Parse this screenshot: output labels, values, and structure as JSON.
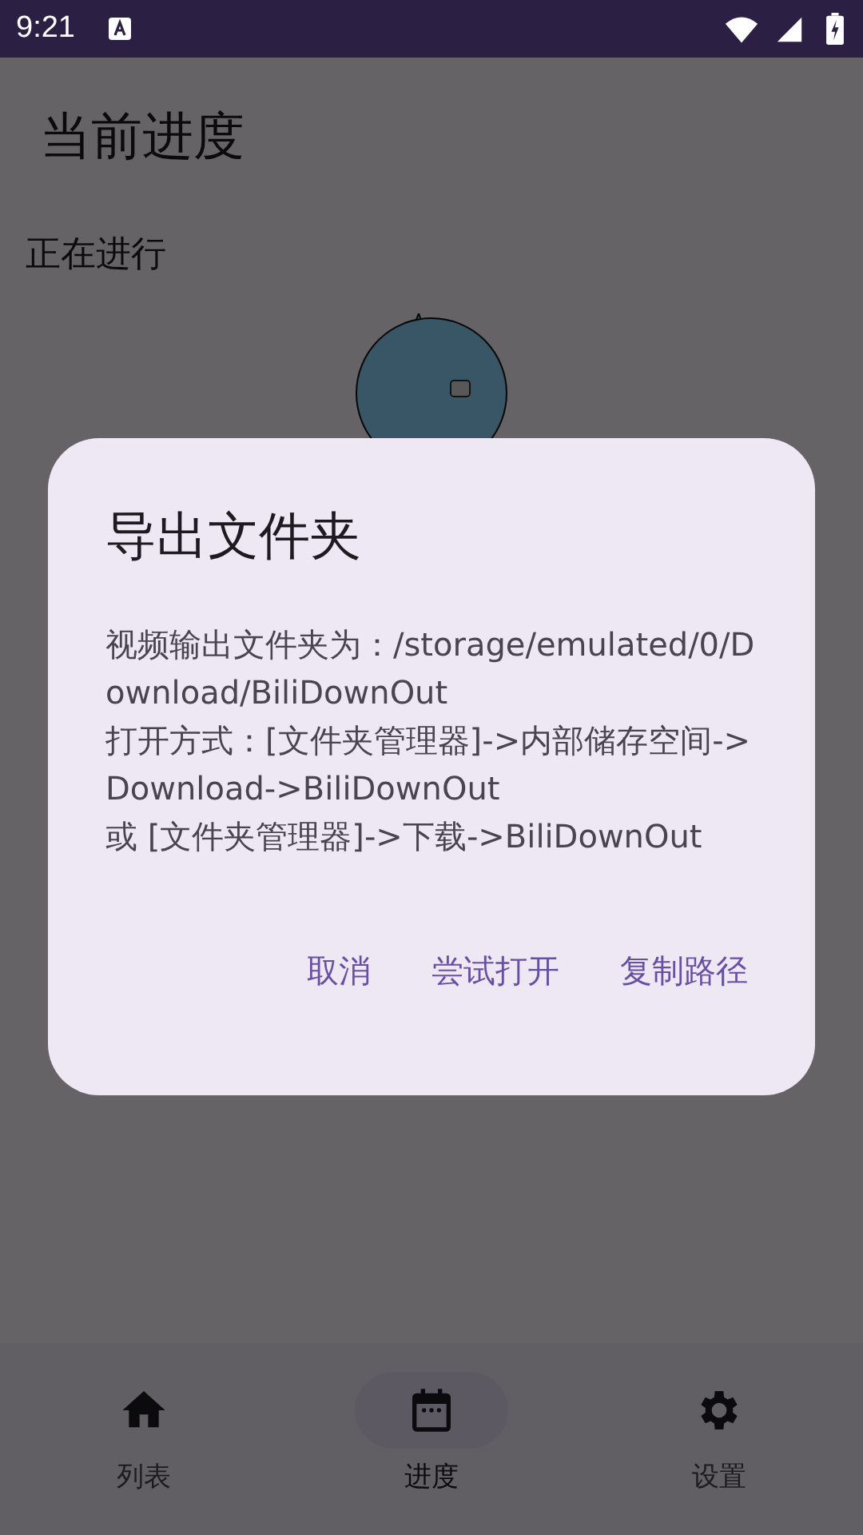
{
  "status_bar": {
    "time": "9:21"
  },
  "page": {
    "title": "当前进度",
    "section": "正在进行"
  },
  "dialog": {
    "title": "导出文件夹",
    "message": "视频输出文件夹为：/storage/emulated/0/Download/BiliDownOut\n打开方式：[文件夹管理器]->内部储存空间->Download->BiliDownOut\n或 [文件夹管理器]->下载->BiliDownOut",
    "buttons": [
      "取消",
      "尝试打开",
      "复制路径"
    ]
  },
  "nav": [
    {
      "label": "列表",
      "kind": "home",
      "selected": false
    },
    {
      "label": "进度",
      "kind": "calendar",
      "selected": true
    },
    {
      "label": "设置",
      "kind": "settings",
      "selected": false
    }
  ]
}
